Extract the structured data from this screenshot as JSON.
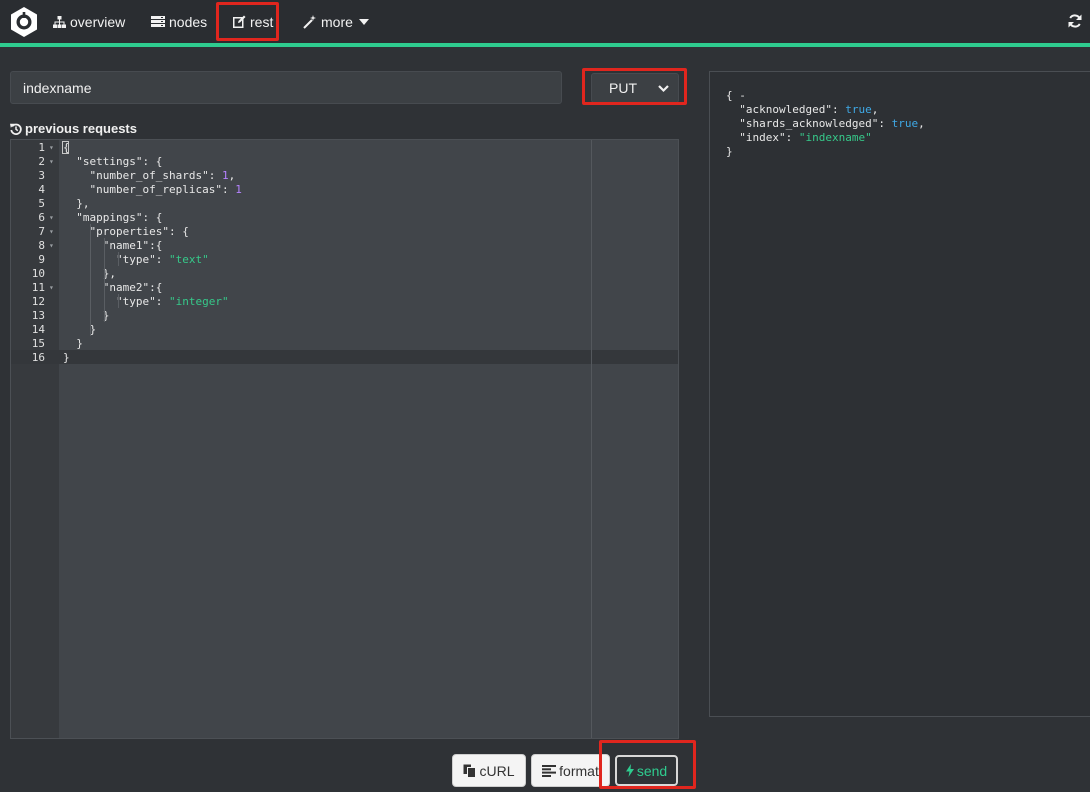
{
  "colors": {
    "accent": "#2ecc8f",
    "highlight": "#e0261e",
    "string": "#36c98a",
    "number": "#b583ff",
    "boolean": "#3fa9e6"
  },
  "nav": {
    "logo_icon": "cerebro-logo-icon",
    "items": [
      {
        "label": "overview",
        "icon": "sitemap-icon"
      },
      {
        "label": "nodes",
        "icon": "server-icon"
      },
      {
        "label": "rest",
        "icon": "edit-icon"
      },
      {
        "label": "more",
        "icon": "magic-wand-icon"
      }
    ],
    "refresh_icon": "refresh-icon"
  },
  "request": {
    "path_value": "indexname",
    "method": "PUT",
    "previous_requests_label": "previous requests"
  },
  "editor": {
    "line_numbers": [
      "1",
      "2",
      "3",
      "4",
      "5",
      "6",
      "7",
      "8",
      "9",
      "10",
      "11",
      "12",
      "13",
      "14",
      "15",
      "16"
    ],
    "foldable_lines": [
      1,
      2,
      6,
      7,
      8,
      11
    ],
    "lines": [
      [
        {
          "t": "{",
          "c": "p"
        }
      ],
      [
        {
          "t": "  ",
          "c": "p"
        },
        {
          "t": "\"settings\"",
          "c": "key"
        },
        {
          "t": ": {",
          "c": "p"
        }
      ],
      [
        {
          "t": "    ",
          "c": "p"
        },
        {
          "t": "\"number_of_shards\"",
          "c": "key"
        },
        {
          "t": ": ",
          "c": "p"
        },
        {
          "t": "1",
          "c": "num"
        },
        {
          "t": ",",
          "c": "p"
        }
      ],
      [
        {
          "t": "    ",
          "c": "p"
        },
        {
          "t": "\"number_of_replicas\"",
          "c": "key"
        },
        {
          "t": ": ",
          "c": "p"
        },
        {
          "t": "1",
          "c": "num"
        }
      ],
      [
        {
          "t": "  },",
          "c": "p"
        }
      ],
      [
        {
          "t": "  ",
          "c": "p"
        },
        {
          "t": "\"mappings\"",
          "c": "key"
        },
        {
          "t": ": {",
          "c": "p"
        }
      ],
      [
        {
          "t": "    ",
          "c": "p"
        },
        {
          "t": "\"properties\"",
          "c": "key"
        },
        {
          "t": ": {",
          "c": "p"
        }
      ],
      [
        {
          "t": "      ",
          "c": "p"
        },
        {
          "t": "\"name1\"",
          "c": "key"
        },
        {
          "t": ":{",
          "c": "p"
        }
      ],
      [
        {
          "t": "        ",
          "c": "p"
        },
        {
          "t": "\"type\"",
          "c": "key"
        },
        {
          "t": ": ",
          "c": "p"
        },
        {
          "t": "\"text\"",
          "c": "str"
        }
      ],
      [
        {
          "t": "      },",
          "c": "p"
        }
      ],
      [
        {
          "t": "      ",
          "c": "p"
        },
        {
          "t": "\"name2\"",
          "c": "key"
        },
        {
          "t": ":{",
          "c": "p"
        }
      ],
      [
        {
          "t": "        ",
          "c": "p"
        },
        {
          "t": "\"type\"",
          "c": "key"
        },
        {
          "t": ": ",
          "c": "p"
        },
        {
          "t": "\"integer\"",
          "c": "str"
        }
      ],
      [
        {
          "t": "      }",
          "c": "p"
        }
      ],
      [
        {
          "t": "    }",
          "c": "p"
        }
      ],
      [
        {
          "t": "  }",
          "c": "p"
        }
      ],
      [
        {
          "t": "}",
          "c": "p"
        }
      ]
    ]
  },
  "response": {
    "lines": [
      [
        {
          "t": "{ -",
          "c": "p"
        }
      ],
      [
        {
          "t": "  ",
          "c": "p"
        },
        {
          "t": "\"acknowledged\"",
          "c": "key"
        },
        {
          "t": ": ",
          "c": "p"
        },
        {
          "t": "true",
          "c": "bool"
        },
        {
          "t": ",",
          "c": "p"
        }
      ],
      [
        {
          "t": "  ",
          "c": "p"
        },
        {
          "t": "\"shards_acknowledged\"",
          "c": "key"
        },
        {
          "t": ": ",
          "c": "p"
        },
        {
          "t": "true",
          "c": "bool"
        },
        {
          "t": ",",
          "c": "p"
        }
      ],
      [
        {
          "t": "  ",
          "c": "p"
        },
        {
          "t": "\"index\"",
          "c": "key"
        },
        {
          "t": ": ",
          "c": "p"
        },
        {
          "t": "\"indexname\"",
          "c": "str"
        }
      ],
      [
        {
          "t": "}",
          "c": "p"
        }
      ]
    ]
  },
  "buttons": {
    "curl": {
      "label": "cURL",
      "icon": "copy-icon"
    },
    "format": {
      "label": "format",
      "icon": "align-left-icon"
    },
    "send": {
      "label": "send",
      "icon": "bolt-icon"
    }
  }
}
